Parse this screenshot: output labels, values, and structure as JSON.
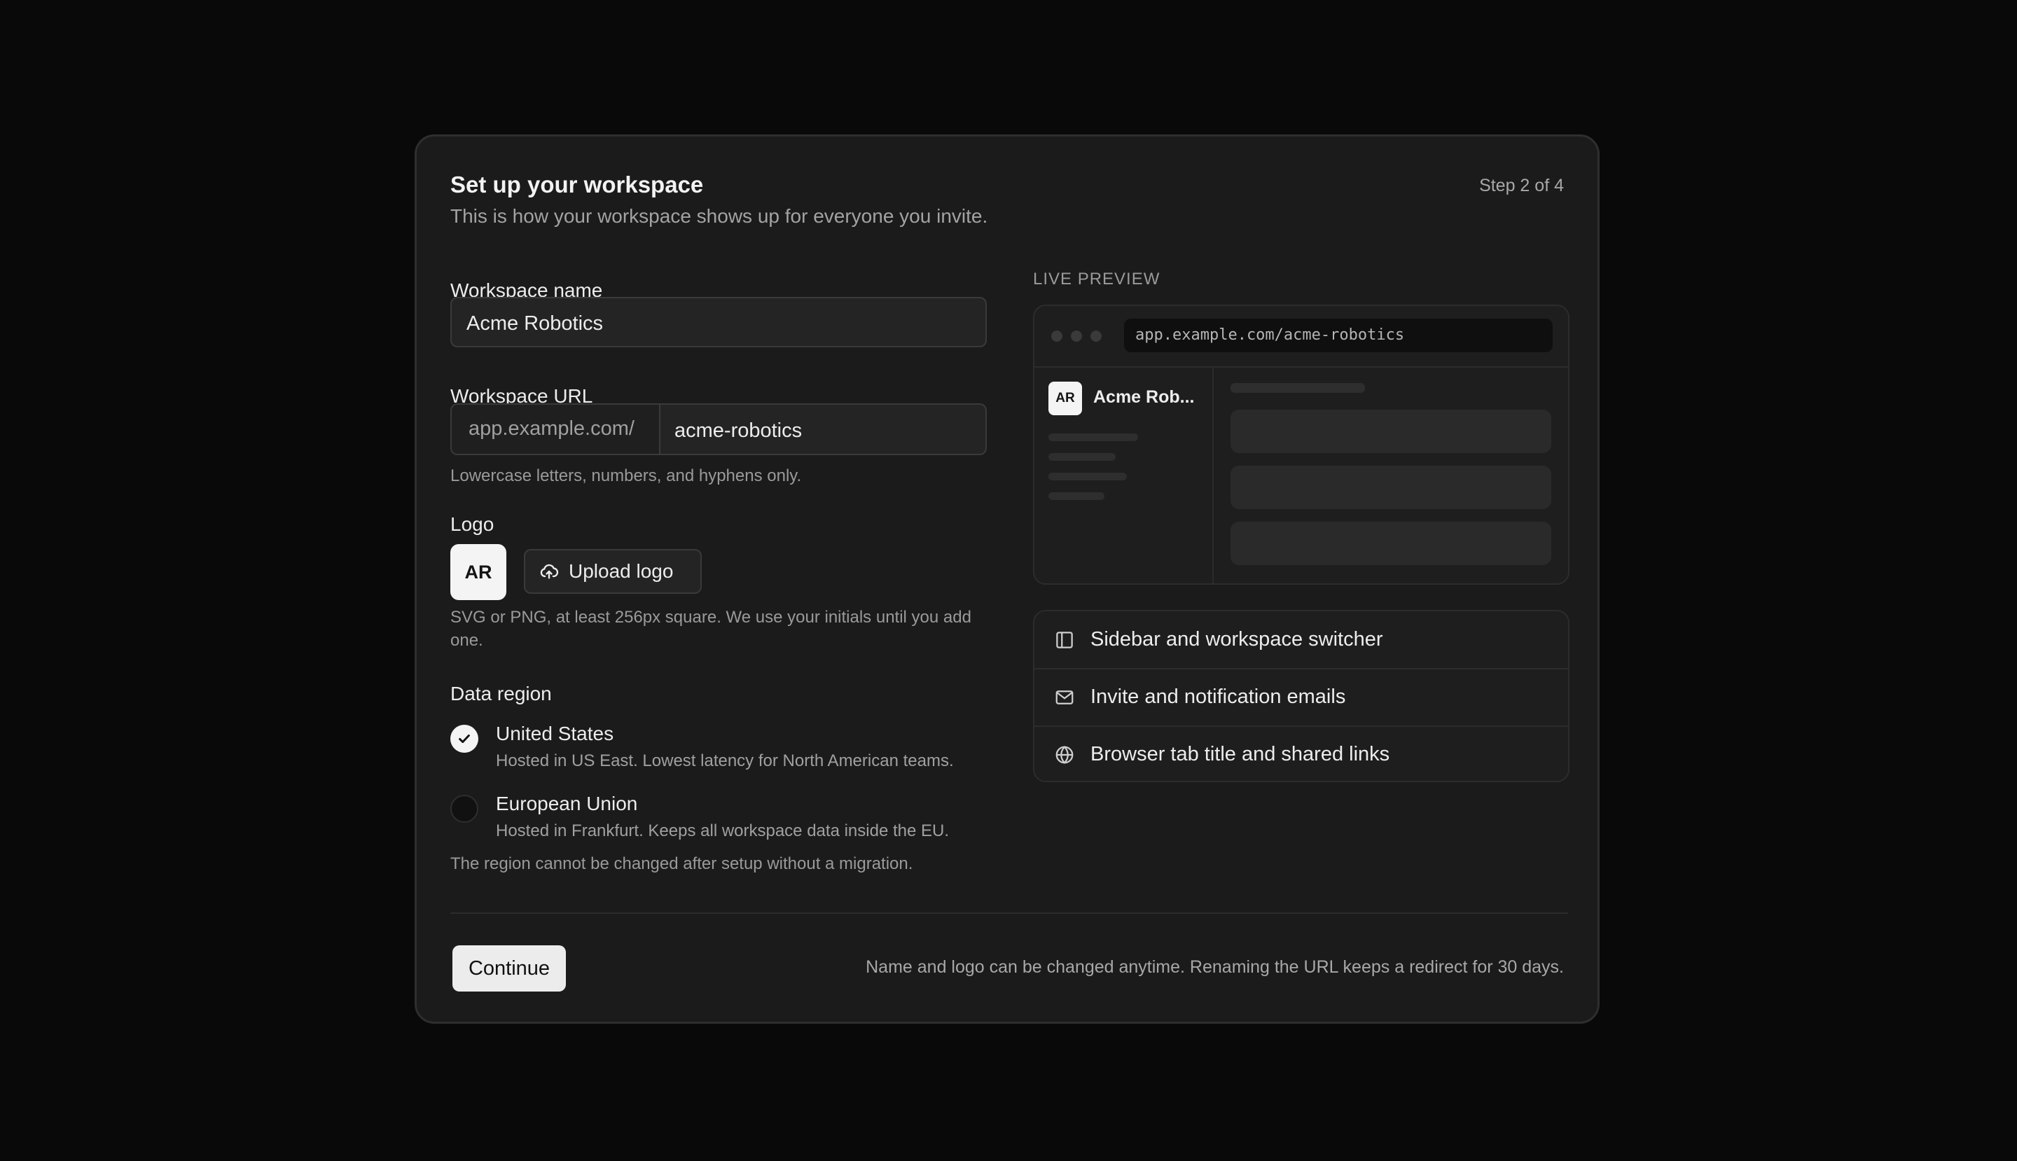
{
  "header": {
    "title": "Set up your workspace",
    "subtitle": "This is how your workspace shows up for everyone you invite.",
    "step": "Step 2 of 4"
  },
  "form": {
    "name_label": "Workspace name",
    "name_value": "Acme Robotics",
    "url_label": "Workspace URL",
    "url_prefix": "app.example.com/",
    "url_value": "acme-robotics",
    "url_hint": "Lowercase letters, numbers, and hyphens only.",
    "logo_label": "Logo",
    "logo_initials": "AR",
    "upload_label": "Upload logo",
    "logo_hint": "SVG or PNG, at least 256px square. We use your initials until you add one.",
    "region_label": "Data region",
    "regions": [
      {
        "title": "United States",
        "desc": "Hosted in US East. Lowest latency for North American teams.",
        "selected": true
      },
      {
        "title": "European Union",
        "desc": "Hosted in Frankfurt. Keeps all workspace data inside the EU.",
        "selected": false
      }
    ],
    "region_note": "The region cannot be changed after setup without a migration."
  },
  "preview": {
    "label": "LIVE PREVIEW",
    "url": "app.example.com/acme-robotics",
    "avatar": "AR",
    "name": "Acme Rob..."
  },
  "features": [
    {
      "icon": "sidebar-icon",
      "label": "Sidebar and workspace switcher"
    },
    {
      "icon": "mail-icon",
      "label": "Invite and notification emails"
    },
    {
      "icon": "globe-icon",
      "label": "Browser tab title and shared links"
    }
  ],
  "footer": {
    "continue_label": "Continue",
    "note": "Name and logo can be changed anytime. Renaming the URL keeps a redirect for 30 days."
  }
}
